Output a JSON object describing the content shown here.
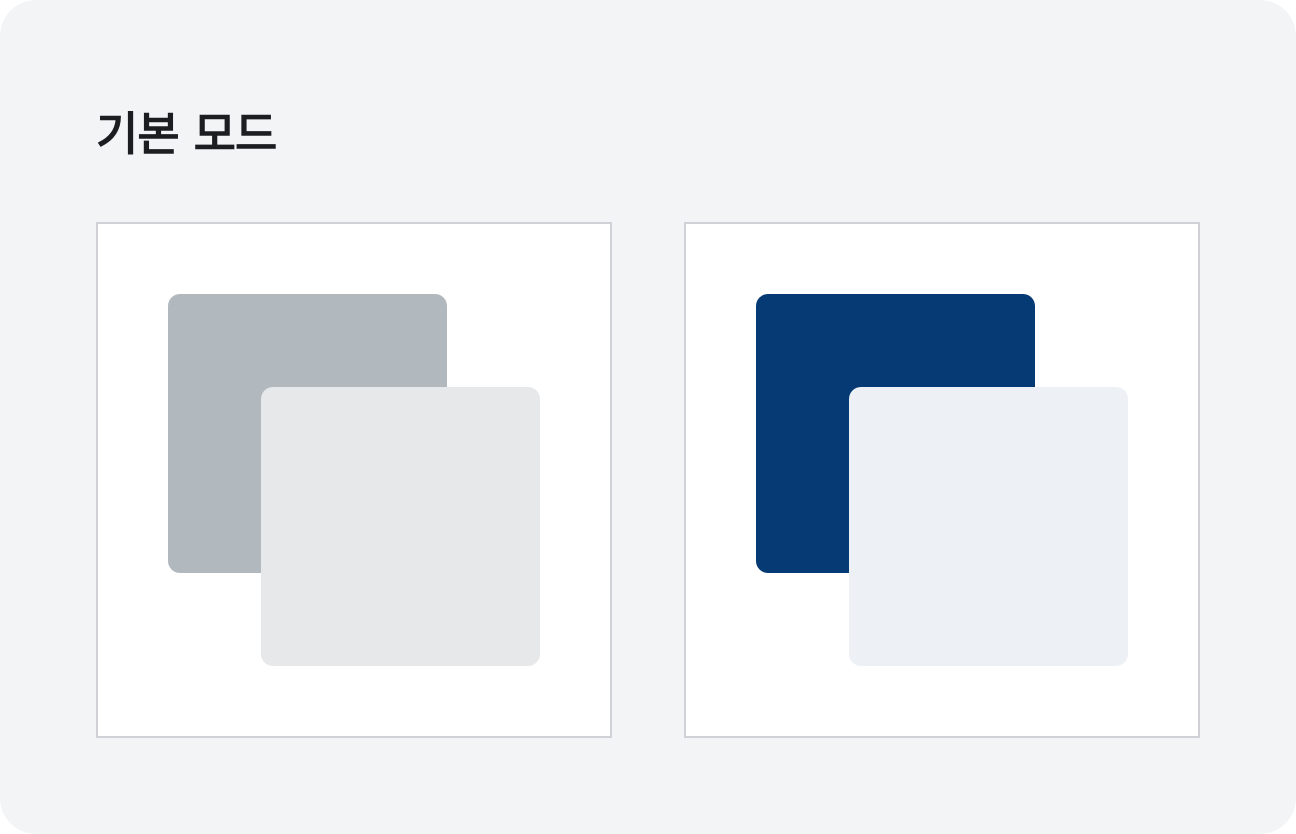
{
  "title": "기본 모드",
  "panels": [
    {
      "id": "default-gray",
      "back_square_color": "#b1b8be",
      "front_square_color": "#e6e8ea"
    },
    {
      "id": "default-blue",
      "back_square_color": "#063a74",
      "front_square_color": "#edf0f5"
    }
  ]
}
